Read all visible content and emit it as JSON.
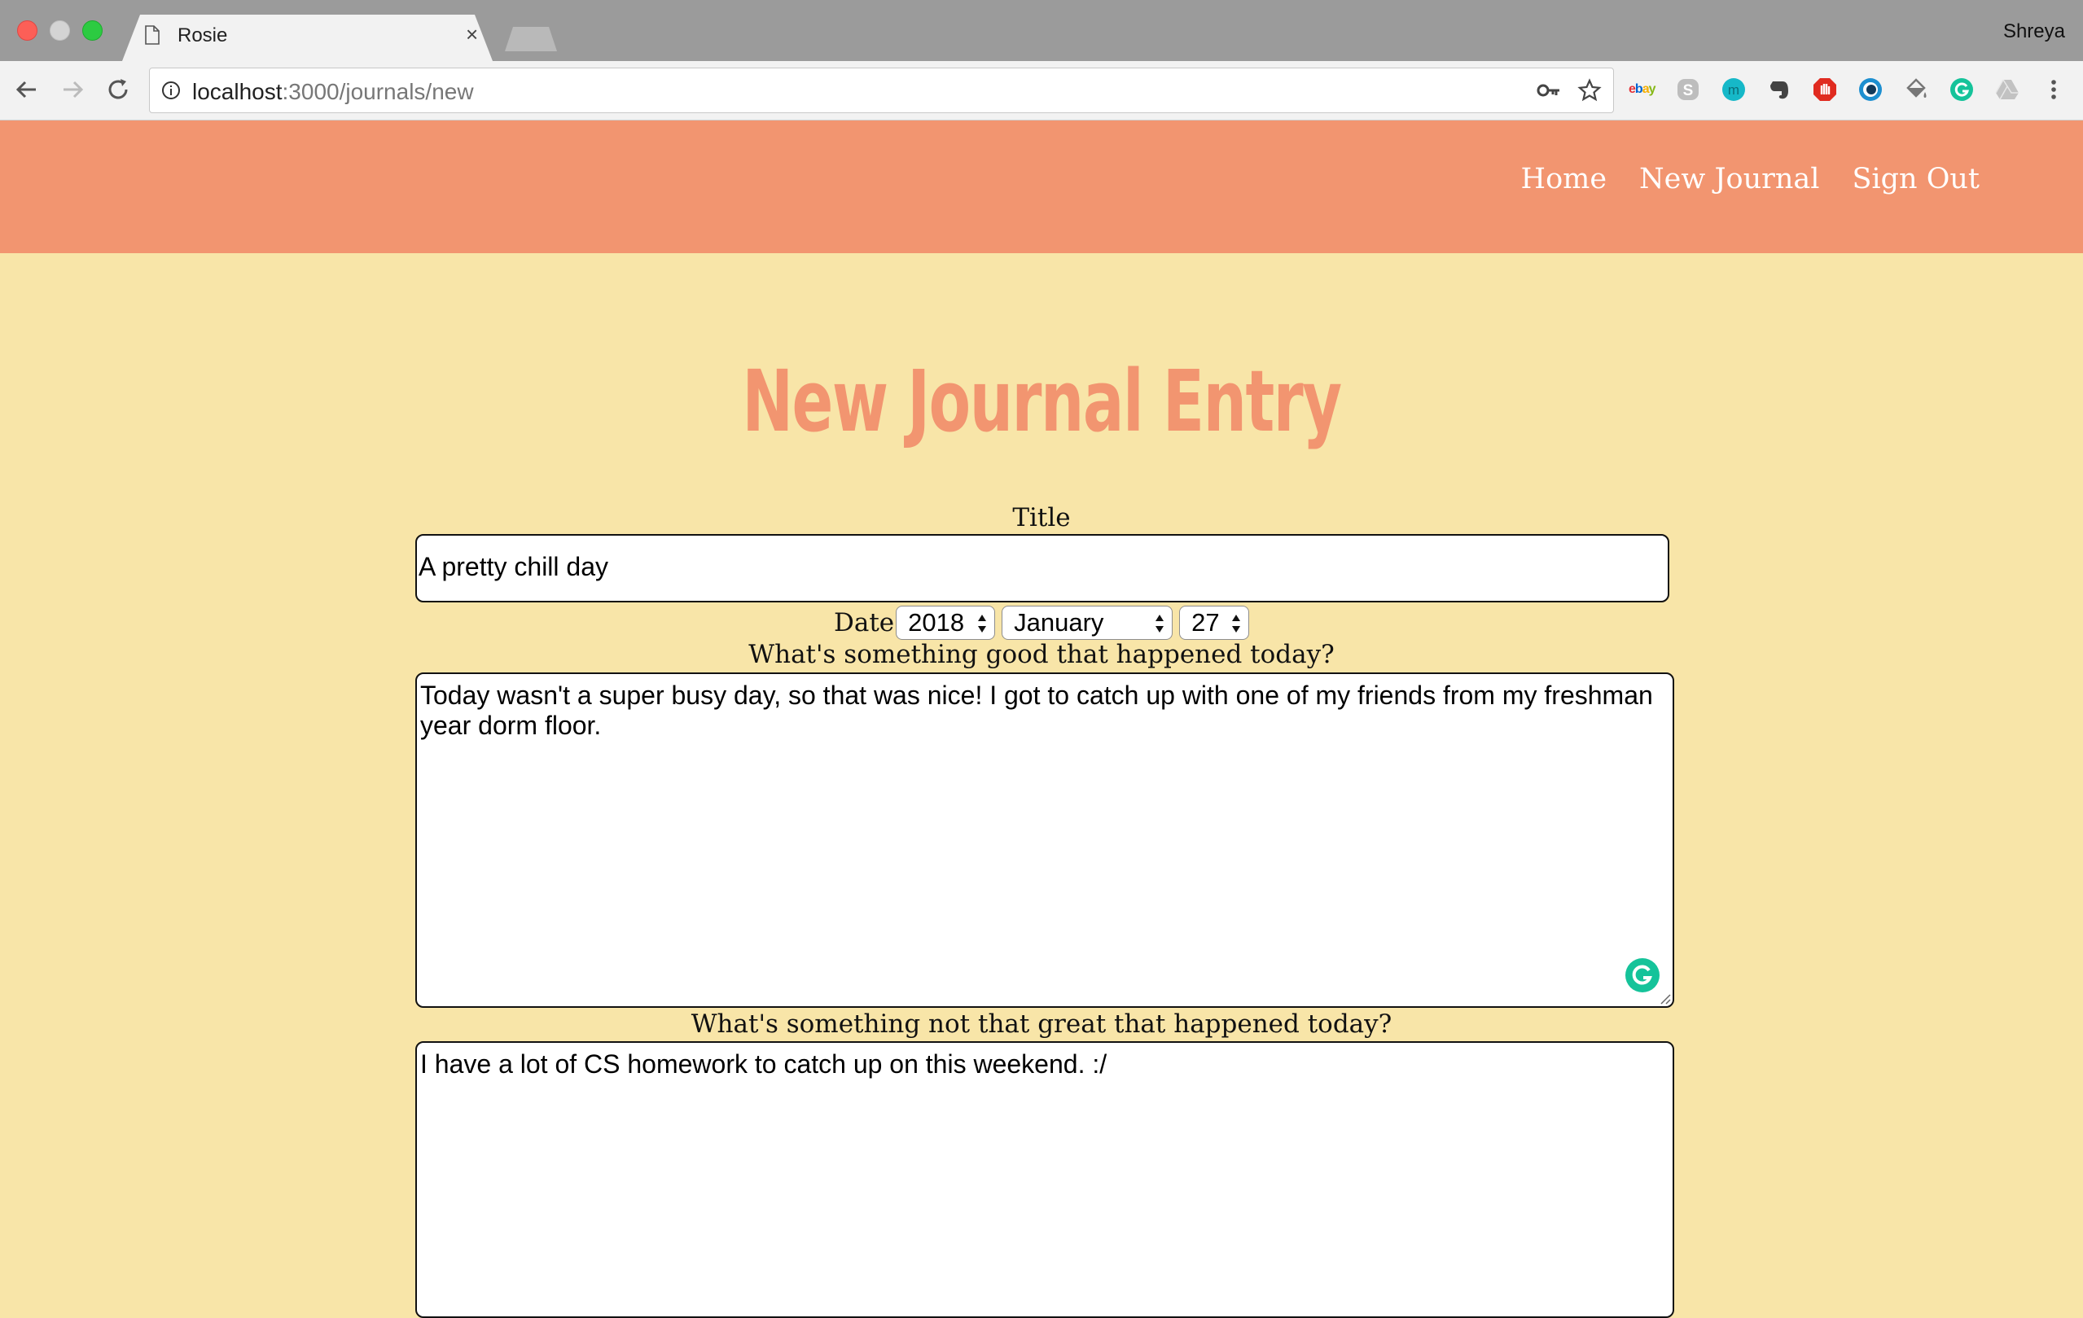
{
  "browser": {
    "tab_title": "Rosie",
    "tab_close": "×",
    "profile_name": "Shreya",
    "url_host": "localhost",
    "url_path": ":3000/journals/new",
    "extensions": [
      "ebay-icon",
      "skype-icon",
      "mendeley-icon",
      "evernote-icon",
      "adblock-icon",
      "tracker-icon",
      "paint-bucket-icon",
      "grammarly-icon",
      "drive-icon"
    ],
    "ebay_label": "ebay"
  },
  "site": {
    "accent_color": "#f29570",
    "background_color": "#f8e5a8",
    "nav": [
      {
        "label": "Home"
      },
      {
        "label": "New Journal"
      },
      {
        "label": "Sign Out"
      }
    ]
  },
  "form": {
    "heading": "New Journal Entry",
    "title_label": "Title",
    "title_value": "A pretty chill day",
    "date_label": "Date",
    "date_year": "2018",
    "date_month": "January",
    "date_day": "27",
    "good_label": "What's something good that happened today?",
    "good_value": "Today wasn't a super busy day, so that was nice! I got to catch up with one of my friends from my freshman year dorm floor.",
    "bad_label": "What's something not that great that happened today?",
    "bad_value": "I have a lot of CS homework to catch up on this weekend. :/"
  }
}
